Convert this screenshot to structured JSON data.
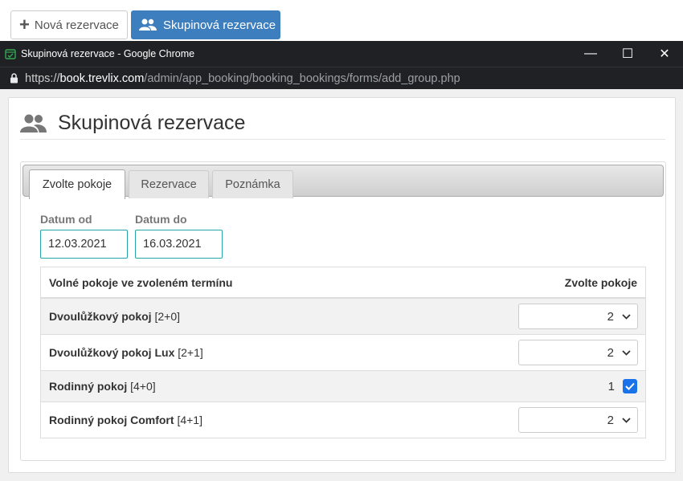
{
  "topbar": {
    "new_button": "Nová rezervace",
    "group_button": "Skupinová rezervace"
  },
  "chrome": {
    "window_title": "Skupinová rezervace - Google Chrome",
    "url_scheme": "https://",
    "url_host": "book.trevlix.com",
    "url_path": "/admin/app_booking/booking_bookings/forms/add_group.php",
    "minimize": "—",
    "maximize": "☐",
    "close": "✕"
  },
  "page": {
    "title": "Skupinová rezervace",
    "tabs": [
      {
        "label": "Zvolte pokoje",
        "active": true
      },
      {
        "label": "Rezervace",
        "active": false
      },
      {
        "label": "Poznámka",
        "active": false
      }
    ],
    "date_from_label": "Datum od",
    "date_from": "12.03.2021",
    "date_to_label": "Datum do",
    "date_to": "16.03.2021",
    "rooms_header": "Volné pokoje ve zvoleném termínu",
    "select_header": "Zvolte pokoje",
    "rooms": [
      {
        "name": "Dvoulůžkový pokoj",
        "capacity": "[2+0]",
        "value": "2",
        "control": "select"
      },
      {
        "name": "Dvoulůžkový pokoj Lux",
        "capacity": "[2+1]",
        "value": "2",
        "control": "select"
      },
      {
        "name": "Rodinný pokoj",
        "capacity": "[4+0]",
        "value": "1",
        "control": "checkbox",
        "checked": true
      },
      {
        "name": "Rodinný pokoj Comfort",
        "capacity": "[4+1]",
        "value": "2",
        "control": "select"
      }
    ]
  },
  "colors": {
    "primary": "#3d7ebf",
    "input_border": "#26a6a6",
    "chrome_bg": "#202124",
    "checkbox": "#1a73e8"
  }
}
